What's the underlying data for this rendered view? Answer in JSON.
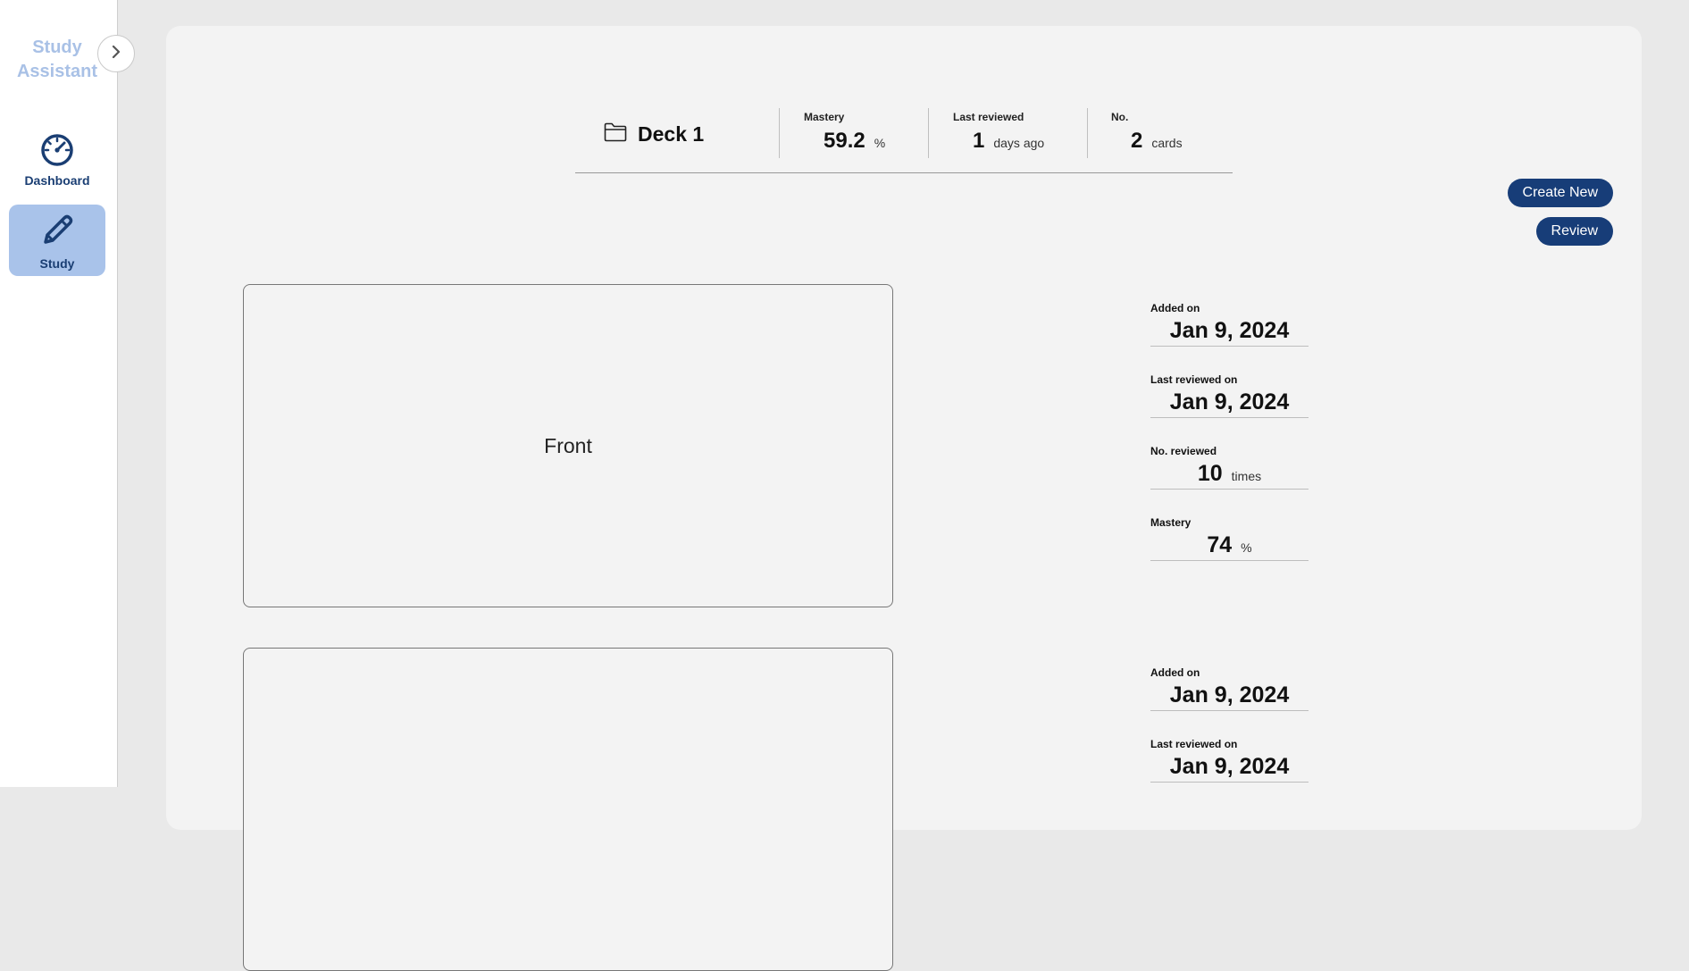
{
  "app": {
    "title": "Study Assistant"
  },
  "sidebar": {
    "items": [
      {
        "label": "Dashboard",
        "icon": "gauge-icon",
        "active": false
      },
      {
        "label": "Study",
        "icon": "pencil-icon",
        "active": true
      }
    ]
  },
  "deck": {
    "title": "Deck 1",
    "stats": [
      {
        "label": "Mastery",
        "value": "59.2",
        "unit": "%"
      },
      {
        "label": "Last reviewed",
        "value": "1",
        "unit": "days ago"
      },
      {
        "label": "No.",
        "value": "2",
        "unit": "cards"
      }
    ]
  },
  "actions": {
    "create_label": "Create New",
    "review_label": "Review"
  },
  "cards": [
    {
      "front": "Front",
      "meta": [
        {
          "label": "Added on",
          "value": "Jan 9, 2024",
          "unit": ""
        },
        {
          "label": "Last reviewed on",
          "value": "Jan 9, 2024",
          "unit": ""
        },
        {
          "label": "No. reviewed",
          "value": "10",
          "unit": "times"
        },
        {
          "label": "Mastery",
          "value": "74",
          "unit": "%"
        }
      ]
    },
    {
      "front": "",
      "meta": [
        {
          "label": "Added on",
          "value": "Jan 9, 2024",
          "unit": ""
        },
        {
          "label": "Last reviewed on",
          "value": "Jan 9, 2024",
          "unit": ""
        }
      ]
    }
  ],
  "colors": {
    "accent": "#173d78",
    "active_nav": "#a9c3ea",
    "title_light": "#a9c1e6"
  }
}
